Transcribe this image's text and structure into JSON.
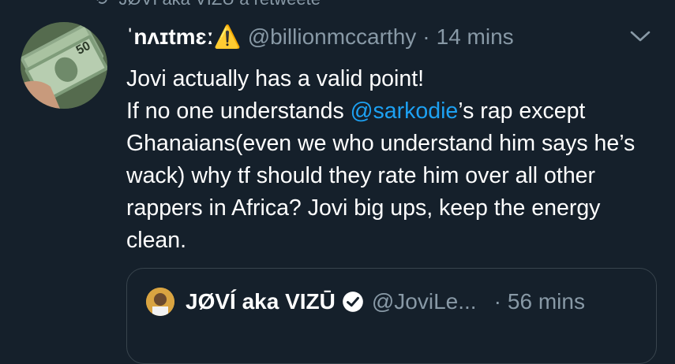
{
  "retweet_bar": {
    "icon": "retweet-icon",
    "text": "JØVÍ aka VIZŪ a retweete"
  },
  "tweet": {
    "display_name": "ˈnʌɪtmɛː",
    "name_emoji": "⚠️",
    "handle": "@billionmccarthy",
    "separator": "·",
    "time": "14 mins",
    "text_parts": {
      "line1": "Jovi actually has a valid point!",
      "before_mention": "If no one understands ",
      "mention": "@sarkodie",
      "after_mention": "’s rap except Ghanaians(even we who understand him says he’s wack) why tf should they rate him over all other rappers in Africa? Jovi big ups, keep the energy clean."
    }
  },
  "quoted_tweet": {
    "display_name": "JØVÍ aka VIZŪ",
    "verified_icon": "verified-badge-icon",
    "handle": "@JoviLe...",
    "separator": "·",
    "time": "56 mins"
  },
  "colors": {
    "background": "#15202b",
    "text": "#ffffff",
    "secondary": "#8899a6",
    "link": "#1da1f2",
    "border": "#38444d"
  }
}
